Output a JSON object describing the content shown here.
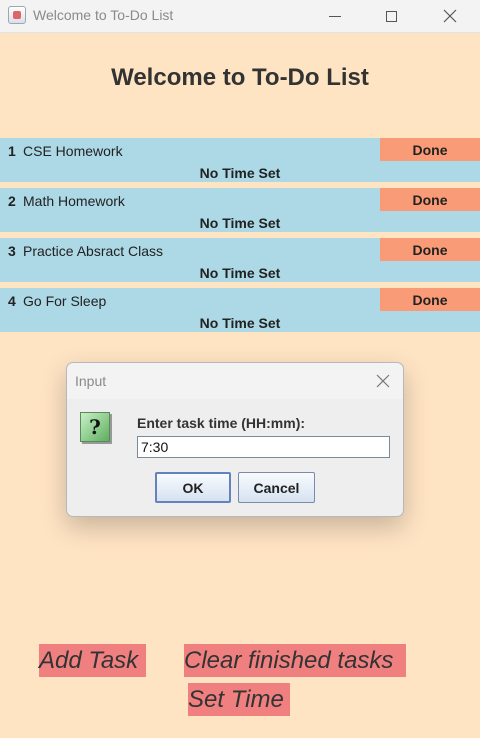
{
  "window": {
    "title": "Welcome to To-Do List"
  },
  "header": {
    "title": "Welcome to To-Do List"
  },
  "tasks": [
    {
      "index": "1",
      "name": "CSE Homework",
      "time": "No Time Set",
      "done_label": "Done"
    },
    {
      "index": "2",
      "name": "Math Homework",
      "time": "No Time Set",
      "done_label": "Done"
    },
    {
      "index": "3",
      "name": "Practice Absract Class",
      "time": "No Time Set",
      "done_label": "Done"
    },
    {
      "index": "4",
      "name": "Go For Sleep",
      "time": "No Time Set",
      "done_label": "Done"
    }
  ],
  "dialog": {
    "title": "Input",
    "icon": "question-icon",
    "icon_glyph": "?",
    "prompt": "Enter task time (HH:mm):",
    "input_value": "7:30",
    "ok_label": "OK",
    "cancel_label": "Cancel"
  },
  "actions": {
    "add_task": "Add Task",
    "clear_finished": "Clear finished tasks",
    "set_time": "Set Time"
  },
  "colors": {
    "background": "#ffe4c4",
    "task_row": "#add8e6",
    "done_button": "#fa9b77",
    "action_button": "#f08080"
  }
}
